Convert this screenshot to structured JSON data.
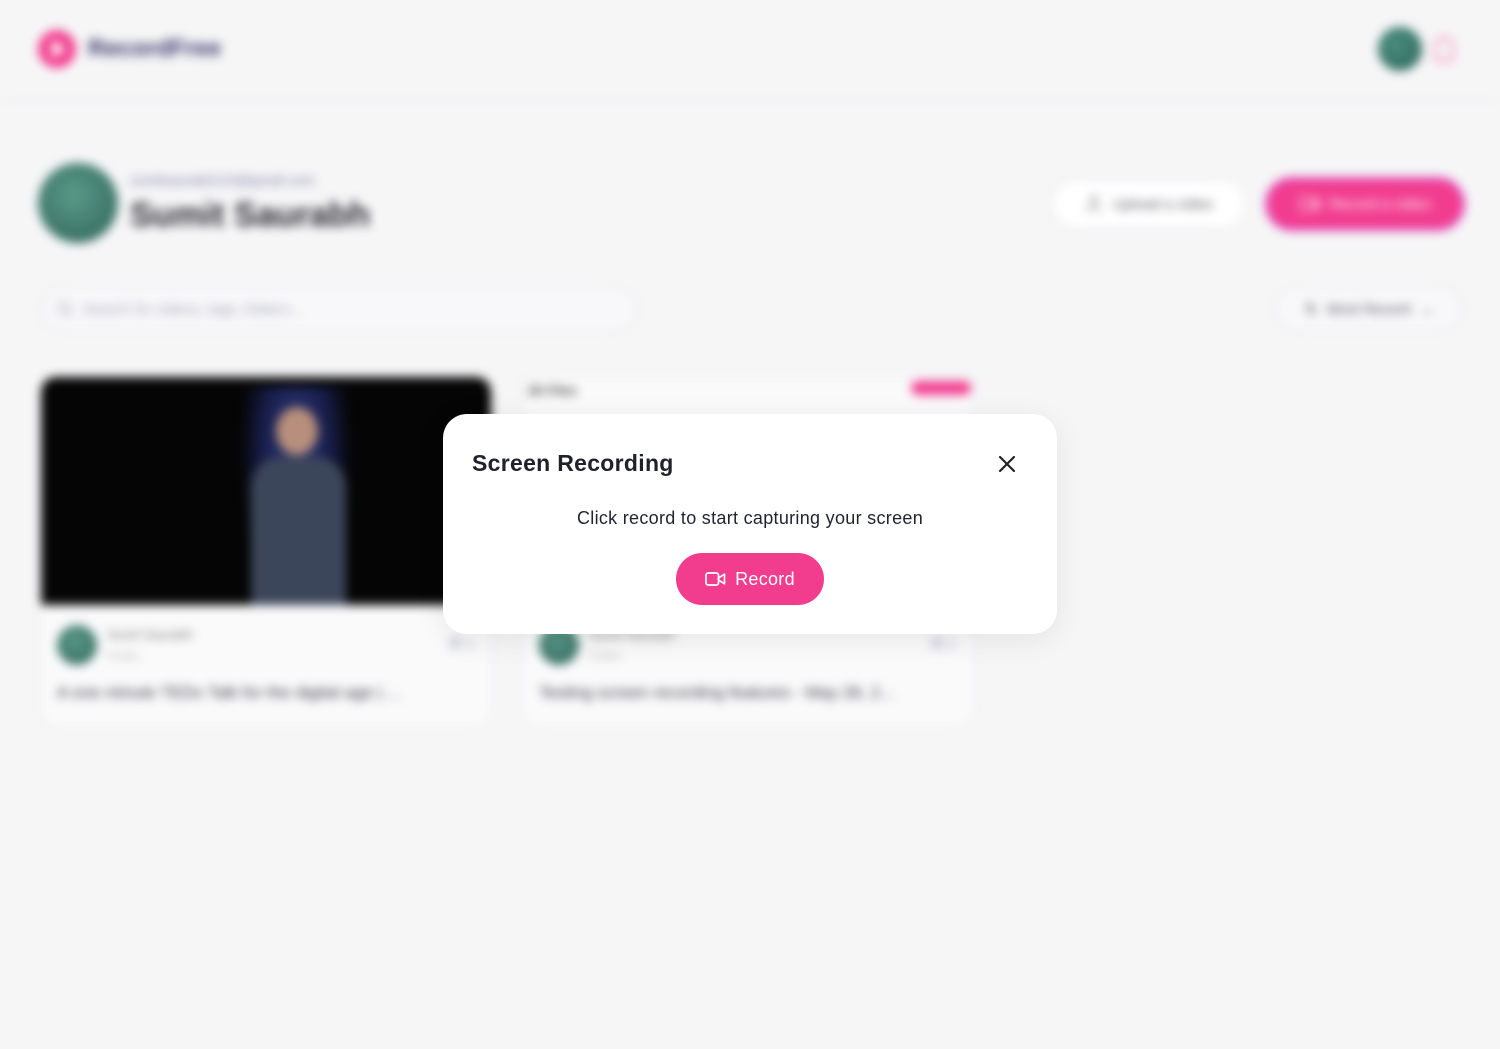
{
  "app": {
    "brand": "RecordFree"
  },
  "profile": {
    "email": "sumitsaurabh115@gmail.com",
    "name": "Sumit Saurabh"
  },
  "actions": {
    "upload_label": "Upload a video",
    "record_label": "Record a video"
  },
  "search": {
    "placeholder": "Search for videos, tags, folders..."
  },
  "sort": {
    "selected": "Most Recent"
  },
  "videos": [
    {
      "author": "Sumit Saurabh",
      "visibility": "Public",
      "views": "1",
      "title": "A one minute TEDx Talk for the digital age | ..."
    },
    {
      "thumb_title": "JD Files",
      "author": "Sumit Saurabh",
      "visibility": "Public",
      "views": "1",
      "title": "Testing screen recording features - May 28, 2..."
    }
  ],
  "modal": {
    "title": "Screen Recording",
    "message": "Click record to start capturing your screen",
    "record_label": "Record"
  },
  "icons": {
    "close": "close-icon",
    "record": "video-camera-icon"
  },
  "colors": {
    "accent": "#f23d8f",
    "modal_bg": "#ffffff",
    "page_bg": "#f6f6f7"
  }
}
